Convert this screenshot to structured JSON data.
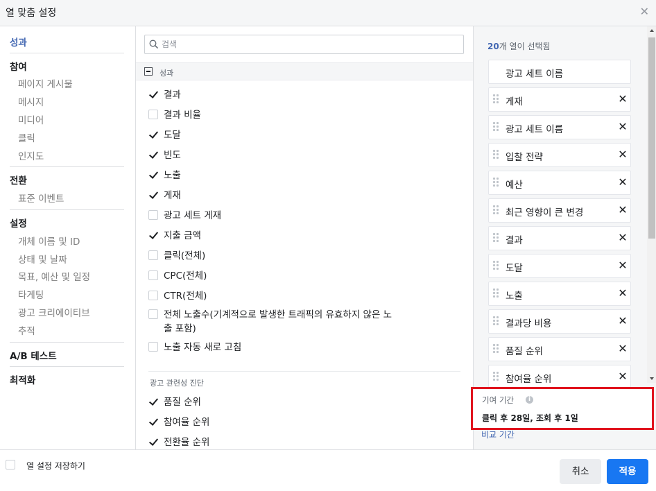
{
  "dialog": {
    "title": "열 맞춤 설정",
    "close_icon": "close-icon"
  },
  "nav": {
    "sections": [
      {
        "label": "성과",
        "active": true,
        "items": []
      },
      {
        "label": "참여",
        "items": [
          "페이지 게시물",
          "메시지",
          "미디어",
          "클릭",
          "인지도"
        ]
      },
      {
        "label": "전환",
        "items": [
          "표준 이벤트"
        ]
      },
      {
        "label": "설정",
        "items": [
          "개체 이름 및 ID",
          "상태 및 날짜",
          "목표, 예산 및 일정",
          "타게팅",
          "광고 크리에이티브",
          "추적"
        ]
      },
      {
        "label": "A/B 테스트",
        "items": []
      },
      {
        "label": "최적화",
        "items": []
      }
    ]
  },
  "search": {
    "placeholder": "검색",
    "value": ""
  },
  "metrics": {
    "group_label": "성과",
    "items": [
      {
        "label": "결과",
        "checked": true
      },
      {
        "label": "결과 비율",
        "checked": false
      },
      {
        "label": "도달",
        "checked": true
      },
      {
        "label": "빈도",
        "checked": true
      },
      {
        "label": "노출",
        "checked": true
      },
      {
        "label": "게재",
        "checked": true
      },
      {
        "label": "광고 세트 게재",
        "checked": false
      },
      {
        "label": "지출 금액",
        "checked": true
      },
      {
        "label": "클릭(전체)",
        "checked": false
      },
      {
        "label": "CPC(전체)",
        "checked": false
      },
      {
        "label": "CTR(전체)",
        "checked": false
      },
      {
        "label": "전체 노출수(기계적으로 발생한 트래픽의 유효하지 않은 노출 포함)",
        "checked": false
      },
      {
        "label": "노출 자동 새로 고침",
        "checked": false
      }
    ],
    "subgroup_label": "광고 관련성 진단",
    "sub_items": [
      {
        "label": "품질 순위",
        "checked": true
      },
      {
        "label": "참여율 순위",
        "checked": true
      },
      {
        "label": "전환율 순위",
        "checked": true
      }
    ]
  },
  "selected": {
    "count": "20",
    "count_suffix": "개 열이 선택됨",
    "fixed": "광고 세트 이름",
    "columns": [
      "게재",
      "광고 세트 이름",
      "입찰 전략",
      "예산",
      "최근 영향이 큰 변경",
      "결과",
      "도달",
      "노출",
      "결과당 비용",
      "품질 순위",
      "참여율 순위"
    ]
  },
  "attribution": {
    "label": "기여 기간",
    "info_icon": "i",
    "value": "클릭 후 28일, 조회 후 1일",
    "compare_link": "비교 기간"
  },
  "footer": {
    "save_label": "열 설정 저장하기",
    "cancel": "취소",
    "apply": "적용"
  }
}
